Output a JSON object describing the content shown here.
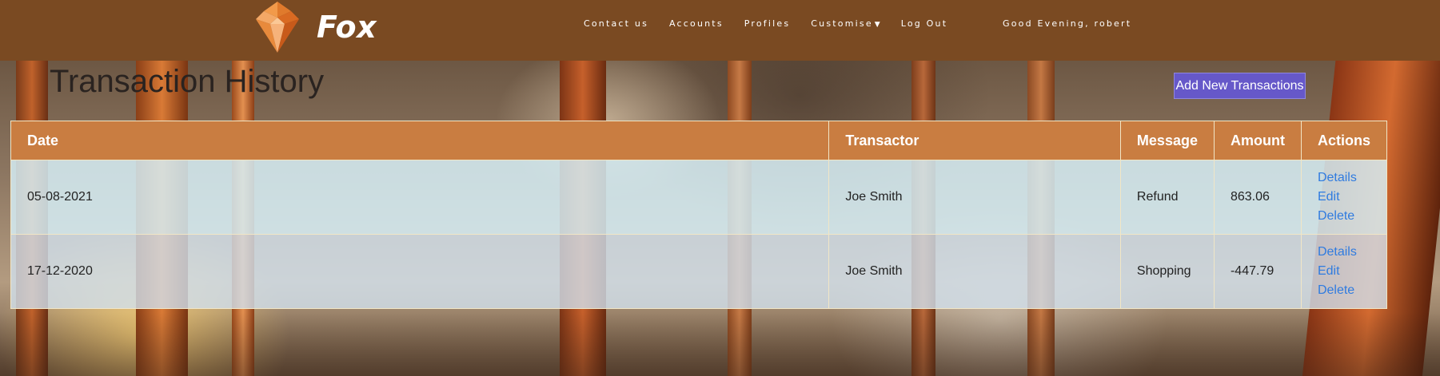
{
  "nav": {
    "brand": "Fox",
    "links": [
      {
        "label": "Contact us"
      },
      {
        "label": "Accounts"
      },
      {
        "label": "Profiles"
      },
      {
        "label": "Customise"
      },
      {
        "label": "Log Out"
      }
    ],
    "greeting": "Good Evening, robert"
  },
  "page": {
    "title": "Transaction History",
    "add_button": "Add New Transactions"
  },
  "table": {
    "headers": [
      "Date",
      "Transactor",
      "Message",
      "Amount",
      "Actions"
    ],
    "rows": [
      {
        "date": "05-08-2021",
        "transactor": "Joe Smith",
        "message": "Refund",
        "amount": "863.06",
        "actions": [
          "Details",
          "Edit",
          "Delete"
        ]
      },
      {
        "date": "17-12-2020",
        "transactor": "Joe Smith",
        "message": "Shopping",
        "amount": "-447.79",
        "actions": [
          "Details",
          "Edit",
          "Delete"
        ]
      }
    ]
  },
  "colors": {
    "navbar": "#7a4a22",
    "table_header": "#c97d41",
    "primary_button": "#6658c9",
    "link": "#2f7be0"
  }
}
